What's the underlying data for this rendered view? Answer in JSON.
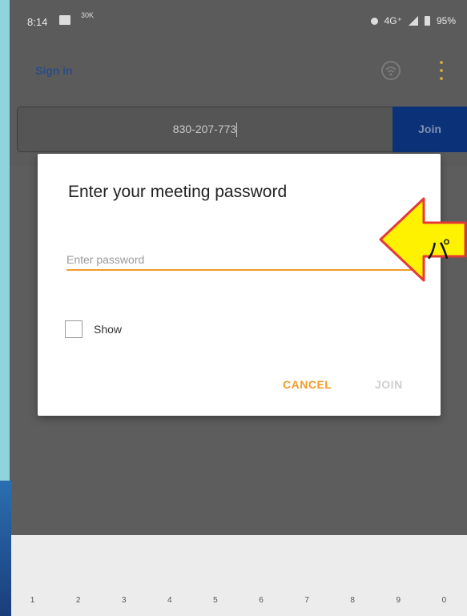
{
  "status_bar": {
    "time": "8:14",
    "data_badge": "30K",
    "network": "4G⁺",
    "battery": "95%"
  },
  "app_header": {
    "sign_in": "Sign in"
  },
  "meeting_id": {
    "value": "830-207-773",
    "join_label": "Join"
  },
  "dialog": {
    "title": "Enter your meeting password",
    "password_placeholder": "Enter password",
    "show_label": "Show",
    "cancel_label": "CANCEL",
    "join_label": "JOIN"
  },
  "annotation": {
    "text": "パ",
    "color": "#fff200",
    "border_color": "#e53935"
  },
  "keyboard": {
    "number_row": [
      "1",
      "2",
      "3",
      "4",
      "5",
      "6",
      "7",
      "8",
      "9",
      "0"
    ]
  },
  "colors": {
    "accent": "#f29b2a",
    "join_button": "#0b3278",
    "sign_in": "#2b4d86"
  }
}
